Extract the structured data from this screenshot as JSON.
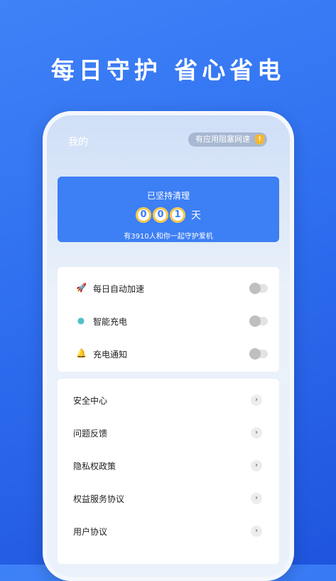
{
  "headline": "每日守护 省心省电",
  "header": {
    "title": "我的",
    "blocked_text": "有应用阻塞网速",
    "shield_glyph": "!"
  },
  "clean_card": {
    "title": "已坚持清理",
    "digits": [
      "0",
      "0",
      "1"
    ],
    "unit": "天",
    "subtitle": "有3910人和你一起守护爱机"
  },
  "toggles": [
    {
      "icon": "rocket-icon",
      "glyph": "🚀",
      "label": "每日自动加速",
      "on": false
    },
    {
      "icon": "robot-icon",
      "glyph": "●",
      "label": "智能充电",
      "on": false
    },
    {
      "icon": "bell-icon",
      "glyph": "🔔",
      "label": "充电通知",
      "on": false
    }
  ],
  "menu": [
    {
      "label": "安全中心"
    },
    {
      "label": "问题反馈"
    },
    {
      "label": "隐私权政策"
    },
    {
      "label": "权益服务协议"
    },
    {
      "label": "用户协议"
    }
  ],
  "arrow_glyph": "›",
  "colors": {
    "accent": "#3d7ff4",
    "shield": "#f5b631"
  }
}
